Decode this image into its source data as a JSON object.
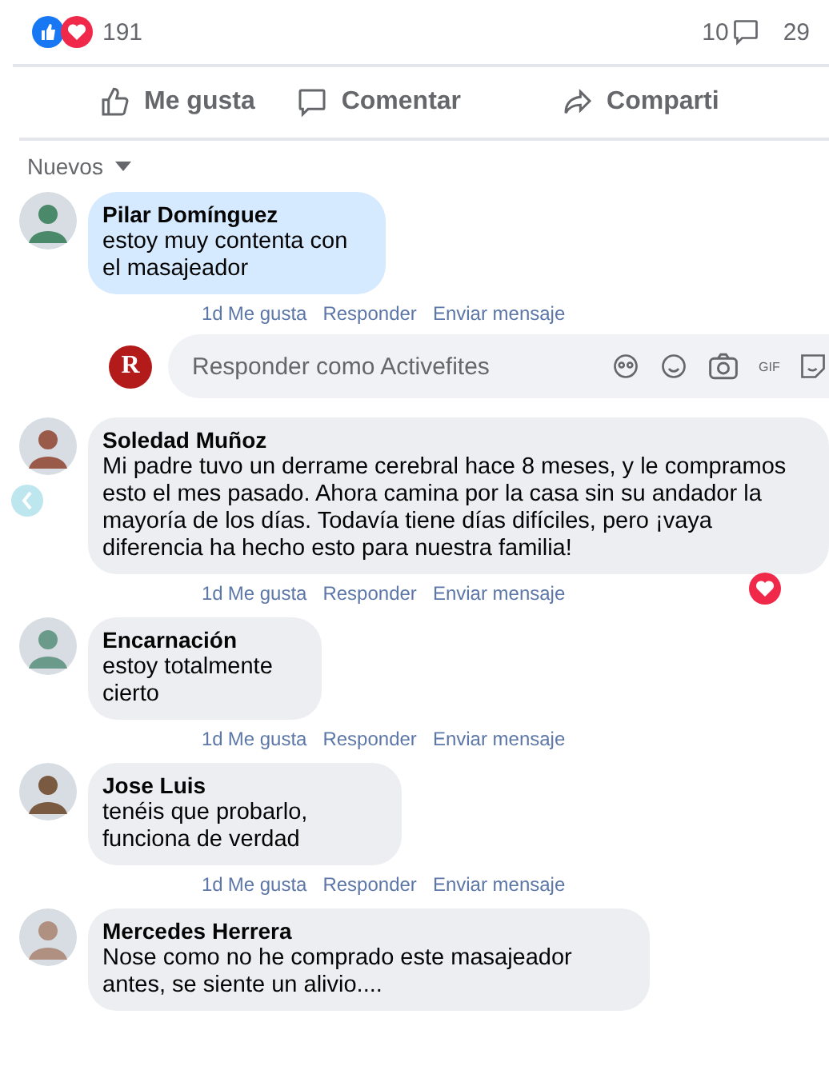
{
  "reactions": {
    "count": "191",
    "comments": "10",
    "shares": "29"
  },
  "actions": [
    {
      "kind": "like",
      "label": "Me gusta"
    },
    {
      "kind": "comment",
      "label": "Comentar"
    },
    {
      "kind": "share",
      "label": "Comparti"
    }
  ],
  "sort": {
    "label": "Nuevos"
  },
  "comments": [
    {
      "author": "Pilar Domínguez",
      "text": "estoy muy contenta con el masajeador",
      "highlighted": true,
      "time": "1d",
      "like": "Me gusta",
      "reply": "Responder",
      "message": "Enviar mensaje",
      "hearted": false,
      "reply_box": {
        "avatar_letter": "R",
        "placeholder": "Responder como Activefites",
        "gif": "GIF"
      }
    },
    {
      "author": "Soledad Muñoz",
      "text": "Mi padre tuvo un derrame cerebral hace 8 meses, y le compramos esto el mes pasado. Ahora camina por la casa sin su andador la mayoría de los días. Todavía tiene días difíciles, pero ¡vaya diferencia ha hecho esto para nuestra familia!",
      "highlighted": false,
      "time": "1d",
      "like": "Me gusta",
      "reply": "Responder",
      "message": "Enviar mensaje",
      "hearted": true
    },
    {
      "author": "Encarnación",
      "text": "estoy totalmente cierto",
      "highlighted": false,
      "time": "1d",
      "like": "Me gusta",
      "reply": "Responder",
      "message": "Enviar mensaje",
      "hearted": false
    },
    {
      "author": "Jose Luis",
      "text": "tenéis que probarlo, funciona de verdad",
      "highlighted": false,
      "time": "1d",
      "like": "Me gusta",
      "reply": "Responder",
      "message": "Enviar mensaje",
      "hearted": false
    },
    {
      "author": "Mercedes Herrera",
      "text": "Nose como no he comprado este masajeador antes, se siente un alivio....",
      "highlighted": false
    }
  ]
}
